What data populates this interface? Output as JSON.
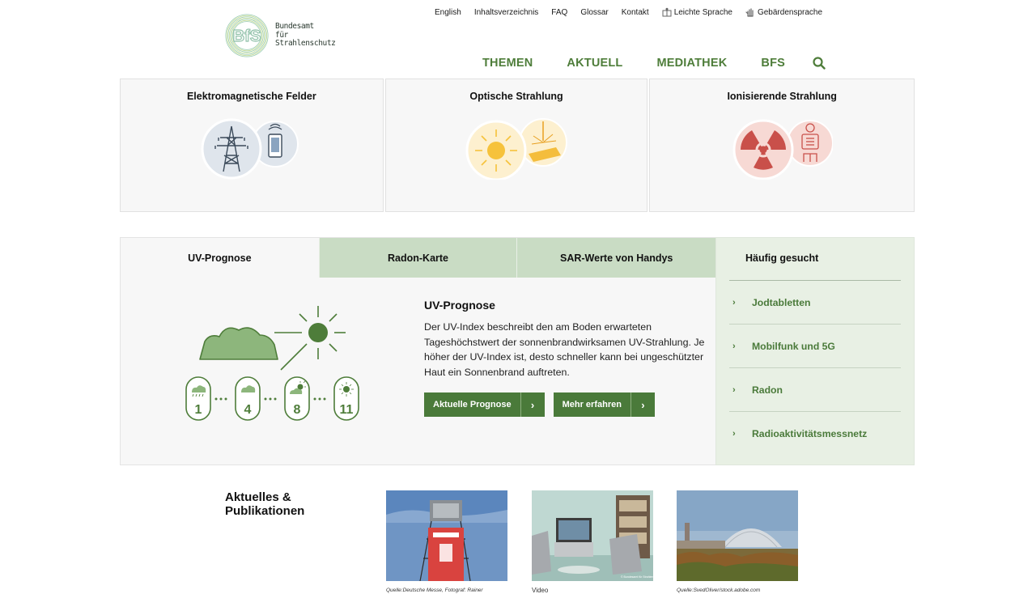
{
  "brand": {
    "logo_mark": "BfS",
    "name_line1": "Bundesamt",
    "name_line2": "für Strahlenschutz"
  },
  "topnav": [
    {
      "label": "English"
    },
    {
      "label": "Inhaltsverzeichnis"
    },
    {
      "label": "FAQ"
    },
    {
      "label": "Glossar"
    },
    {
      "label": "Kontakt"
    },
    {
      "label": "Leichte Sprache",
      "icon": "easy-language-icon"
    },
    {
      "label": "Gebärdensprache",
      "icon": "sign-language-icon"
    }
  ],
  "mainnav": {
    "items": [
      "THEMEN",
      "AKTUELL",
      "MEDIATHEK",
      "BFS"
    ],
    "search_icon": "search-icon"
  },
  "categories": [
    {
      "title": "Elektromagnetische Felder",
      "icons": [
        "power-pylon-icon",
        "mobile-phone-icon"
      ]
    },
    {
      "title": "Optische Strahlung",
      "icons": [
        "sun-icon",
        "laser-icon"
      ]
    },
    {
      "title": "Ionisierende Strahlung",
      "icons": [
        "radiation-icon",
        "xray-person-icon"
      ]
    }
  ],
  "tabs": {
    "items": [
      "UV-Prognose",
      "Radon-Karte",
      "SAR-Werte von Handys"
    ],
    "active": "UV-Prognose"
  },
  "uv_panel": {
    "heading": "UV-Prognose",
    "text": "Der UV-Index beschreibt den am Boden erwarteten Tageshöchstwert der sonnenbrandwirksamen UV-Strahlung. Je höher der UV-Index ist, desto schneller kann bei ungeschützter Haut ein Sonnenbrand auftreten.",
    "index_levels": [
      "1",
      "4",
      "8",
      "11"
    ],
    "button_primary": "Aktuelle Prognose",
    "button_secondary": "Mehr erfahren"
  },
  "faq": {
    "title": "Häufig gesucht",
    "items": [
      "Jodtabletten",
      "Mobilfunk und 5G",
      "Radon",
      "Radioaktivitätsmessnetz"
    ]
  },
  "news": {
    "heading_line1": "Aktuelles &",
    "heading_line2": "Publikationen",
    "cards": [
      {
        "caption": "Quelle:Deutsche Messe, Fotograf: Rainer"
      },
      {
        "caption": "Video"
      },
      {
        "caption": "Quelle:SvedOliver/stock.adobe.com"
      }
    ]
  },
  "colors": {
    "accent_green": "#4e7d3a",
    "button_green": "#4a7a3a",
    "tab_green": "#c9dcc4",
    "faq_bg": "#e8f0e4",
    "ionizing_red": "#c9504a"
  }
}
